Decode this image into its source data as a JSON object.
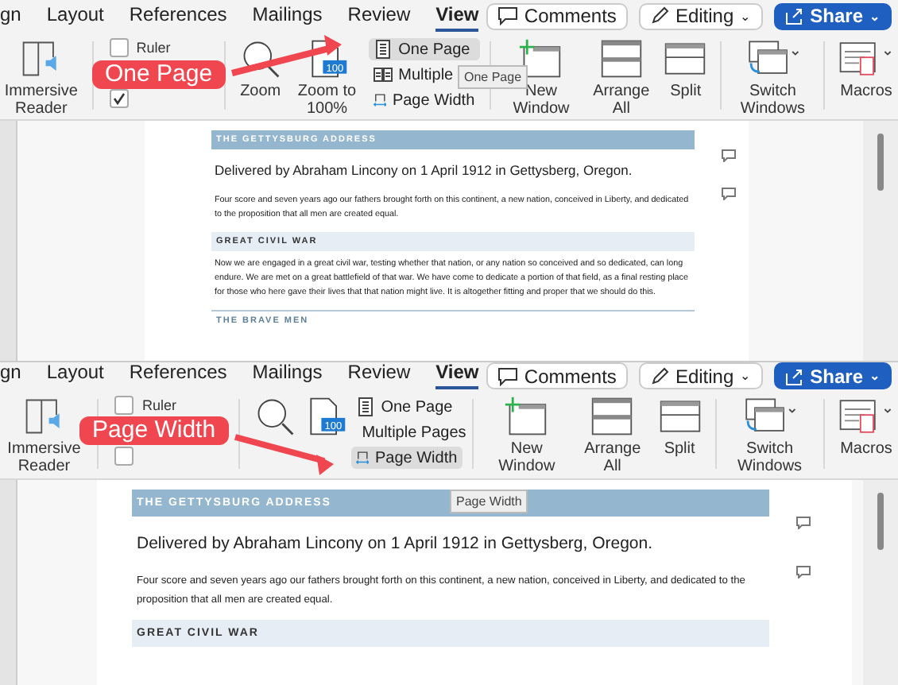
{
  "panels": [
    {
      "tabs": [
        {
          "label": "gn",
          "selected": false
        },
        {
          "label": "Layout",
          "selected": false
        },
        {
          "label": "References",
          "selected": false
        },
        {
          "label": "Mailings",
          "selected": false
        },
        {
          "label": "Review",
          "selected": false
        },
        {
          "label": "View",
          "selected": true
        }
      ],
      "top_buttons": [
        {
          "kind": "comments",
          "label": "Comments"
        },
        {
          "kind": "editing",
          "label": "Editing",
          "caret": "⌄"
        },
        {
          "kind": "share",
          "label": "Share",
          "caret": "⌄"
        }
      ],
      "immersive_reader": "Immersive Reader",
      "checkboxes": [
        {
          "label": "Ruler",
          "checked": false
        },
        {
          "checked": true
        }
      ],
      "zoom": {
        "label": "Zoom"
      },
      "zoom_100": {
        "label": "Zoom to 100%",
        "badge": "100"
      },
      "view_options": [
        {
          "kind": "one_page",
          "label": "One Page",
          "selected": true
        },
        {
          "kind": "multiple",
          "label": "Multiple",
          "selected": false
        },
        {
          "kind": "page_width",
          "label": "Page Width",
          "selected": false
        }
      ],
      "window_buttons": [
        {
          "kind": "new_window",
          "label": "New Window"
        },
        {
          "kind": "arrange",
          "label": "Arrange All"
        },
        {
          "kind": "split",
          "label": "Split"
        },
        {
          "kind": "switch",
          "label": "Switch Windows"
        },
        {
          "kind": "macros",
          "label": "Macros"
        }
      ],
      "tooltip": "One Page",
      "callout": "One Page",
      "document": [
        {
          "kind": "heading",
          "text": "THE GETTYSBURG ADDRESS"
        },
        {
          "kind": "title",
          "text": "Delivered by Abraham Lincony on 1 April 1912 in Gettysberg, Oregon.",
          "comment": true
        },
        {
          "kind": "para",
          "text": "Four score and seven years ago our fathers brought forth on this continent, a new nation, conceived in Liberty, and dedicated to the proposition that all men are created equal.",
          "comment": true
        },
        {
          "kind": "section",
          "text": "GREAT CIVIL WAR"
        },
        {
          "kind": "para",
          "text": "Now we are engaged in a great civil war, testing whether that nation, or any nation so conceived and so dedicated, can long endure. We are met on a great battlefield of that war. We have come to dedicate a portion of that field, as a final resting place for those who here gave their lives that that nation might live. It is altogether fitting and proper that we should do this.",
          "comment": false
        },
        {
          "kind": "subhead",
          "text": "THE BRAVE MEN"
        }
      ]
    },
    {
      "tabs": [
        {
          "label": "gn",
          "selected": false
        },
        {
          "label": "Layout",
          "selected": false
        },
        {
          "label": "References",
          "selected": false
        },
        {
          "label": "Mailings",
          "selected": false
        },
        {
          "label": "Review",
          "selected": false
        },
        {
          "label": "View",
          "selected": true
        }
      ],
      "top_buttons": [
        {
          "kind": "comments",
          "label": "Comments"
        },
        {
          "kind": "editing",
          "label": "Editing",
          "caret": "⌄"
        },
        {
          "kind": "share",
          "label": "Share",
          "caret": "⌄"
        }
      ],
      "immersive_reader": "Immersive Reader",
      "checkboxes": [
        {
          "label": "Ruler",
          "checked": false
        },
        {
          "checked": false
        }
      ],
      "zoom_100": {
        "badge": "100"
      },
      "view_options": [
        {
          "kind": "one_page",
          "label": "One Page",
          "selected": false
        },
        {
          "kind": "multiple",
          "label": "Multiple Pages",
          "selected": false
        },
        {
          "kind": "page_width",
          "label": "Page Width",
          "selected": true
        }
      ],
      "window_buttons": [
        {
          "kind": "new_window",
          "label": "New Window"
        },
        {
          "kind": "arrange",
          "label": "Arrange All"
        },
        {
          "kind": "split",
          "label": "Split"
        },
        {
          "kind": "switch",
          "label": "Switch Windows"
        },
        {
          "kind": "macros",
          "label": "Macros"
        }
      ],
      "tooltip": "Page Width",
      "callout": "Page Width",
      "document": [
        {
          "kind": "heading",
          "text": "THE GETTYSBURG ADDRESS"
        },
        {
          "kind": "title",
          "text": "Delivered by Abraham Lincony on 1 April 1912 in Gettysberg, Oregon.",
          "comment": true
        },
        {
          "kind": "para",
          "text": "Four score and seven years ago our fathers brought forth on this continent, a new nation, conceived in Liberty, and dedicated to the proposition that all men are created equal.",
          "comment": true
        },
        {
          "kind": "section",
          "text": "GREAT CIVIL WAR"
        }
      ]
    }
  ]
}
